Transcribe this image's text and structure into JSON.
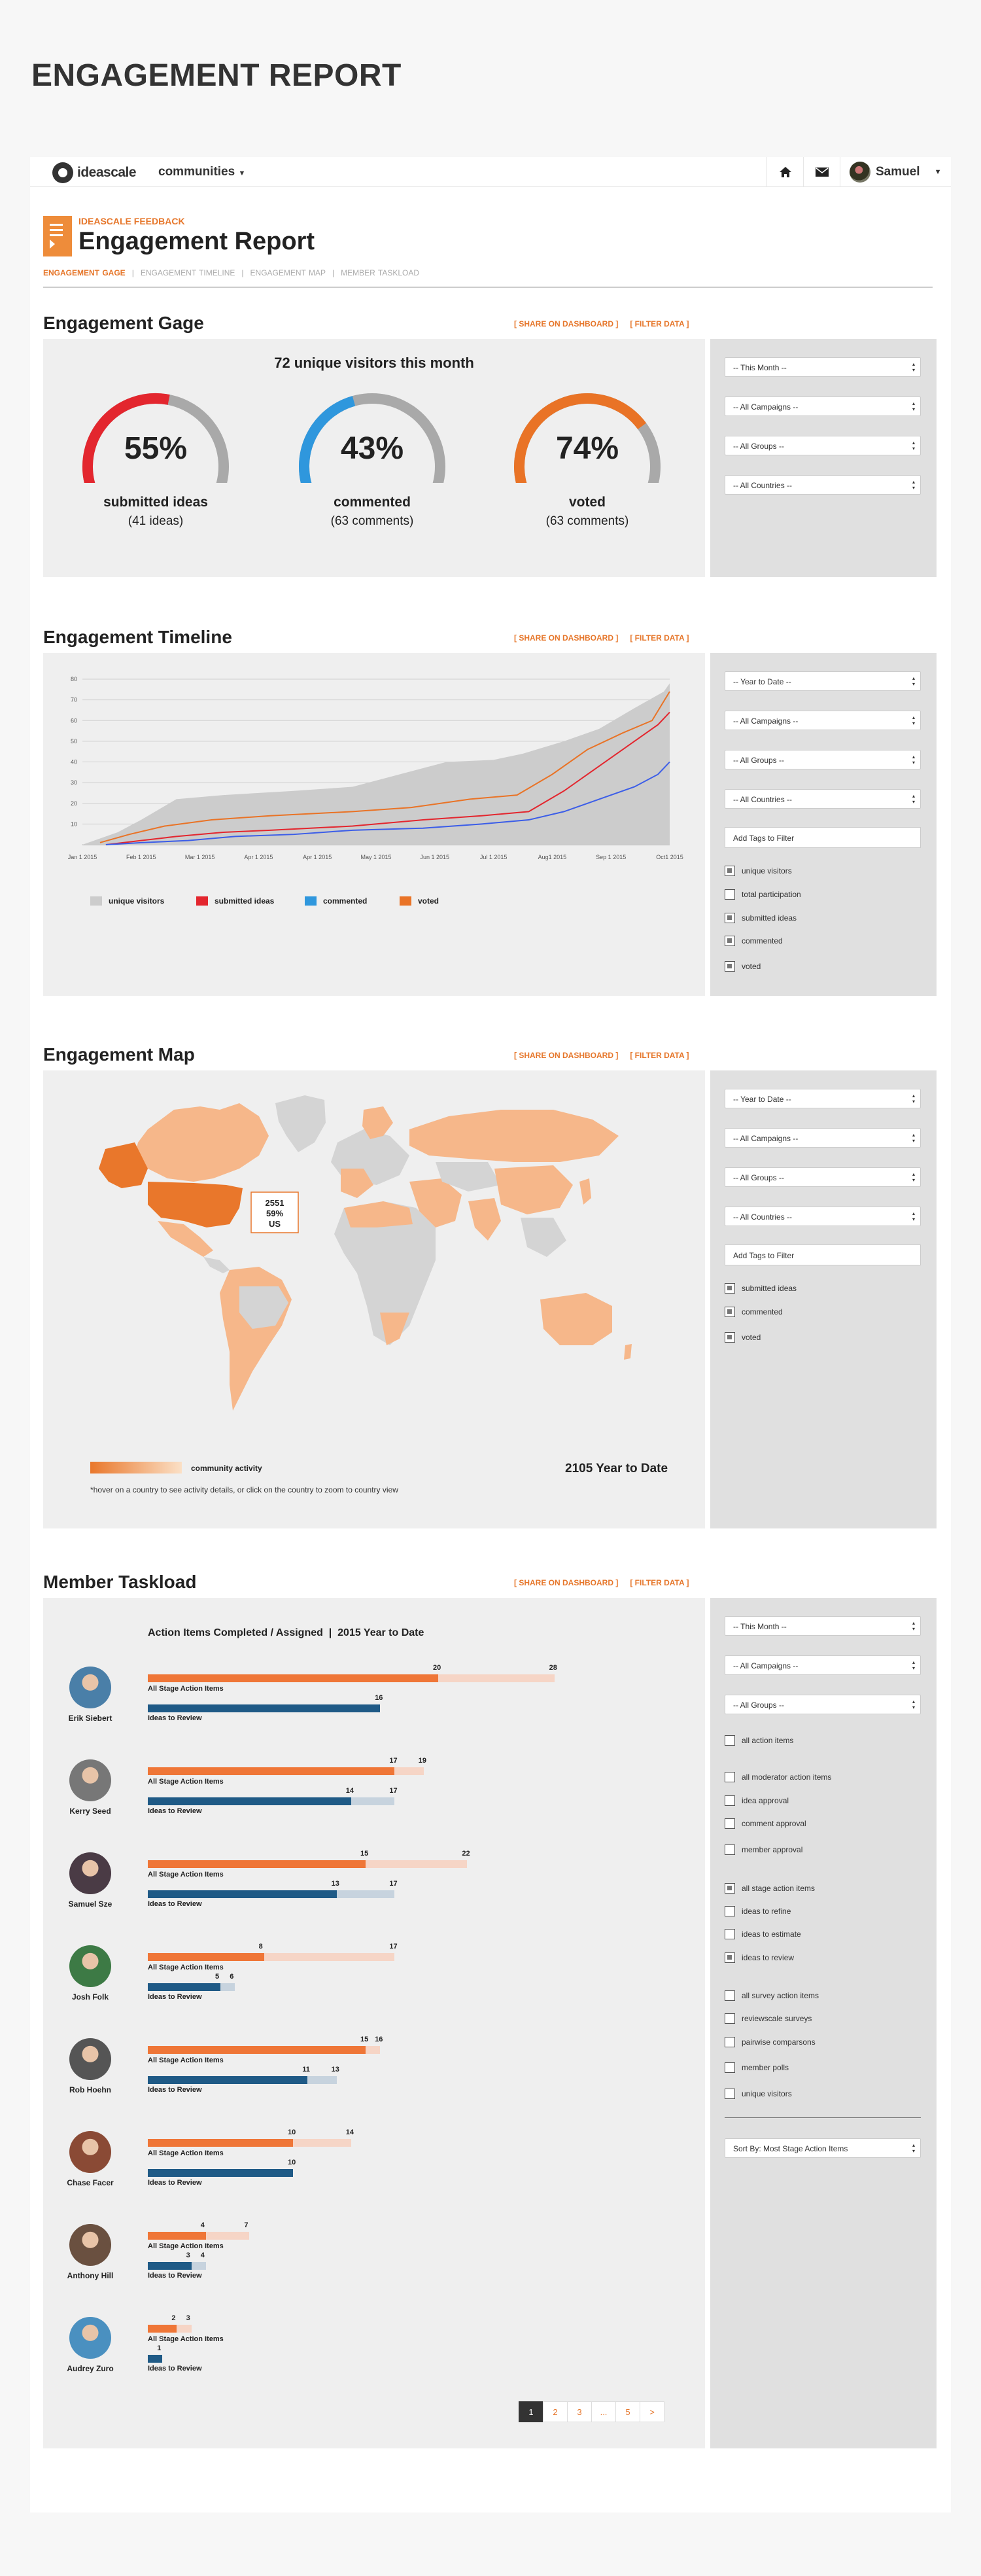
{
  "page_title": "ENGAGEMENT REPORT",
  "nav": {
    "brand": "ideascale",
    "communities": "communities",
    "user": "Samuel"
  },
  "header": {
    "subtitle": "IDEASCALE FEEDBACK",
    "title": "Engagement Report",
    "breadcrumbs": [
      "ENGAGEMENT GAGE",
      "ENGAGEMENT TIMELINE",
      "ENGAGEMENT MAP",
      "MEMBER TASKLOAD"
    ]
  },
  "actions": {
    "share": "[ SHARE ON DASHBOARD ]",
    "filter": "[ FILTER DATA ]"
  },
  "gage": {
    "title": "Engagement Gage",
    "headline": "72 unique visitors this month",
    "gauges": [
      {
        "pct": "55%",
        "value": 55,
        "label": "submitted ideas",
        "sub": "(41 ideas)",
        "color": "#e3262e"
      },
      {
        "pct": "43%",
        "value": 43,
        "label": "commented",
        "sub": "(63 comments)",
        "color": "#2f97dd"
      },
      {
        "pct": "74%",
        "value": 74,
        "label": "voted",
        "sub": "(63 comments)",
        "color": "#e97326"
      }
    ],
    "filters": [
      "-- This Month --",
      "-- All Campaigns --",
      "-- All Groups --",
      "-- All Countries --"
    ]
  },
  "timeline": {
    "title": "Engagement Timeline",
    "filters": [
      "-- Year to Date --",
      "-- All Campaigns --",
      "-- All Groups --",
      "-- All Countries --"
    ],
    "tag_placeholder": "Add Tags to Filter",
    "checks": [
      {
        "label": "unique visitors",
        "checked": true
      },
      {
        "label": "total participation",
        "checked": false
      },
      {
        "label": "submitted ideas",
        "checked": true
      },
      {
        "label": "commented",
        "checked": true
      },
      {
        "label": "voted",
        "checked": true
      }
    ]
  },
  "chart_data": {
    "type": "line",
    "title": "",
    "x": [
      "Jan 1 2015",
      "Feb 1 2015",
      "Mar 1 2015",
      "Apr 1 2015",
      "Apr 1 2015",
      "May 1 2015",
      "Jun 1 2015",
      "Jul 1 2015",
      "Aug1 2015",
      "Sep 1 2015",
      "Oct1 2015"
    ],
    "ylim": [
      0,
      80
    ],
    "yticks": [
      10,
      20,
      30,
      40,
      50,
      60,
      70,
      80
    ],
    "grid": true,
    "legend_position": "bottom",
    "series": [
      {
        "name": "unique visitors",
        "color": "#cccccc",
        "type": "area",
        "points": [
          [
            0,
            0
          ],
          [
            0.3,
            3
          ],
          [
            0.6,
            6
          ],
          [
            1.0,
            12
          ],
          [
            1.6,
            22
          ],
          [
            2.4,
            24
          ],
          [
            3.6,
            26
          ],
          [
            4.6,
            28
          ],
          [
            5.4,
            34
          ],
          [
            6.2,
            40
          ],
          [
            7.0,
            41
          ],
          [
            7.5,
            44
          ],
          [
            8.2,
            50
          ],
          [
            8.8,
            56
          ],
          [
            9.4,
            66
          ],
          [
            9.9,
            74
          ],
          [
            10.0,
            78
          ]
        ]
      },
      {
        "name": "submitted ideas",
        "color": "#e3262e",
        "type": "line",
        "points": [
          [
            0.4,
            0
          ],
          [
            1.0,
            2
          ],
          [
            1.6,
            4
          ],
          [
            2.4,
            6
          ],
          [
            3.2,
            7
          ],
          [
            4.6,
            9
          ],
          [
            5.8,
            12
          ],
          [
            6.8,
            14
          ],
          [
            7.6,
            16
          ],
          [
            8.2,
            26
          ],
          [
            8.8,
            38
          ],
          [
            9.3,
            48
          ],
          [
            9.8,
            58
          ],
          [
            10.0,
            64
          ]
        ]
      },
      {
        "name": "commented",
        "color": "#3b5de8",
        "type": "line",
        "points": [
          [
            0.4,
            0
          ],
          [
            1.0,
            1
          ],
          [
            1.8,
            2
          ],
          [
            2.6,
            4
          ],
          [
            3.6,
            5
          ],
          [
            4.6,
            7
          ],
          [
            5.8,
            8
          ],
          [
            6.8,
            10
          ],
          [
            7.6,
            12
          ],
          [
            8.2,
            16
          ],
          [
            8.8,
            22
          ],
          [
            9.4,
            28
          ],
          [
            9.8,
            34
          ],
          [
            10.0,
            40
          ]
        ]
      },
      {
        "name": "voted",
        "color": "#e97326",
        "type": "line",
        "points": [
          [
            0.3,
            1
          ],
          [
            0.8,
            5
          ],
          [
            1.4,
            9
          ],
          [
            2.2,
            12
          ],
          [
            3.2,
            14
          ],
          [
            4.6,
            16
          ],
          [
            5.6,
            18
          ],
          [
            6.6,
            22
          ],
          [
            7.4,
            24
          ],
          [
            8.0,
            34
          ],
          [
            8.6,
            46
          ],
          [
            9.2,
            54
          ],
          [
            9.7,
            60
          ],
          [
            10.0,
            74
          ]
        ]
      }
    ]
  },
  "map": {
    "title": "Engagement Map",
    "filters": [
      "-- Year to Date --",
      "-- All Campaigns --",
      "-- All Groups --",
      "-- All Countries --"
    ],
    "tag_placeholder": "Add Tags to Filter",
    "checks": [
      {
        "label": "submitted ideas",
        "checked": true
      },
      {
        "label": "commented",
        "checked": true
      },
      {
        "label": "voted",
        "checked": true
      }
    ],
    "tooltip": [
      "2551",
      "59%",
      "US"
    ],
    "scale_label": "community activity",
    "total": "2105 Year to Date",
    "note": "*hover on a country to see activity details, or click on the country to zoom to country view"
  },
  "taskload": {
    "title": "Member Taskload",
    "chart_title": "Action Items Completed / Assigned  |  2015 Year to Date",
    "bar1_label": "All Stage Action Items",
    "bar2_label": "Ideas to Review",
    "members": [
      {
        "name": "Erik Siebert",
        "a_done": 20,
        "a_total": 28,
        "r_done": 16,
        "r_total": 16
      },
      {
        "name": "Kerry Seed",
        "a_done": 17,
        "a_total": 19,
        "r_done": 14,
        "r_total": 17
      },
      {
        "name": "Samuel Sze",
        "a_done": 15,
        "a_total": 22,
        "r_done": 13,
        "r_total": 17
      },
      {
        "name": "Josh Folk",
        "a_done": 8,
        "a_total": 17,
        "r_done": 5,
        "r_total": 6
      },
      {
        "name": "Rob Hoehn",
        "a_done": 15,
        "a_total": 16,
        "r_done": 11,
        "r_total": 13
      },
      {
        "name": "Chase Facer",
        "a_done": 10,
        "a_total": 14,
        "r_done": 10,
        "r_total": 10
      },
      {
        "name": "Anthony Hill",
        "a_done": 4,
        "a_total": 7,
        "r_done": 3,
        "r_total": 4
      },
      {
        "name": "Audrey Zuro",
        "a_done": 2,
        "a_total": 3,
        "r_done": 1,
        "r_total": 1
      }
    ],
    "filters": [
      "-- This Month --",
      "-- All Campaigns --",
      "-- All Groups --"
    ],
    "checks": [
      {
        "label": "all action items",
        "checked": false
      },
      {
        "label": "all moderator action items",
        "checked": false
      },
      {
        "label": "idea approval",
        "checked": false
      },
      {
        "label": "comment approval",
        "checked": false
      },
      {
        "label": "member approval",
        "checked": false
      },
      {
        "label": "all stage action items",
        "checked": true
      },
      {
        "label": "ideas to refine",
        "checked": false
      },
      {
        "label": "ideas to estimate",
        "checked": false
      },
      {
        "label": "ideas to review",
        "checked": true
      },
      {
        "label": "all survey action items",
        "checked": false
      },
      {
        "label": "reviewscale surveys",
        "checked": false
      },
      {
        "label": "pairwise comparsons",
        "checked": false
      },
      {
        "label": "member polls",
        "checked": false
      },
      {
        "label": "unique visitors",
        "checked": false
      }
    ],
    "sort": "Sort By: Most Stage Action Items",
    "pages": [
      "1",
      "2",
      "3",
      "...",
      "5",
      ">"
    ]
  }
}
